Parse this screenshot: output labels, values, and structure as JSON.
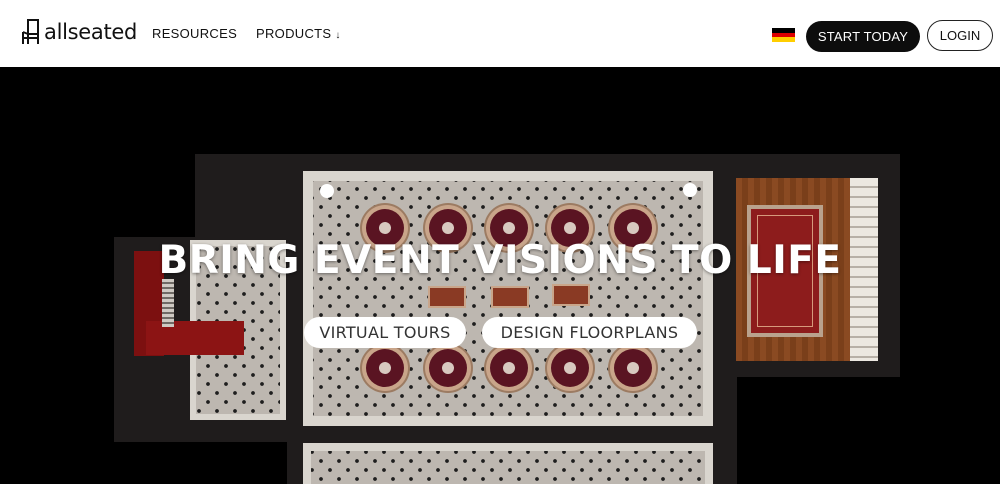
{
  "header": {
    "logo_text": "allseated",
    "nav": [
      {
        "label": "RESOURCES"
      },
      {
        "label": "PRODUCTS",
        "caret": "↓"
      }
    ],
    "language_flag": "germany-flag",
    "start_label": "START TODAY",
    "login_label": "LOGIN"
  },
  "hero": {
    "title": "BRING EVENT VISIONS TO LIFE",
    "buttons": [
      {
        "label": "VIRTUAL TOURS"
      },
      {
        "label": "DESIGN FLOORPLANS"
      }
    ]
  },
  "colors": {
    "header_bg": "#ffffff",
    "hero_bg": "#000000",
    "primary_button": "#0d0d0d",
    "flag_black": "#000000",
    "flag_red": "#dd0000",
    "flag_gold": "#ffce00"
  }
}
